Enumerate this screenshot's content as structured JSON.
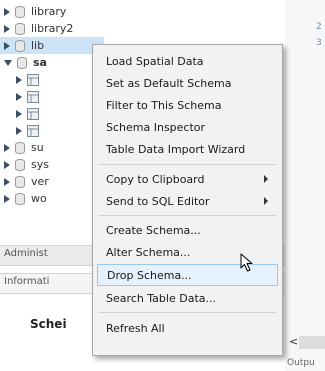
{
  "tree": {
    "items": [
      {
        "label": "library",
        "state": "collapsed",
        "kind": "schema"
      },
      {
        "label": "library2",
        "state": "collapsed",
        "kind": "schema"
      },
      {
        "label": "lib",
        "state": "collapsed",
        "kind": "schema",
        "selected": true
      },
      {
        "label": "sa",
        "state": "expanded",
        "kind": "schema",
        "bold": true
      },
      {
        "label": "",
        "state": "collapsed",
        "kind": "folder"
      },
      {
        "label": "",
        "state": "collapsed",
        "kind": "folder"
      },
      {
        "label": "",
        "state": "collapsed",
        "kind": "folder"
      },
      {
        "label": "",
        "state": "collapsed",
        "kind": "folder"
      },
      {
        "label": "su",
        "state": "collapsed",
        "kind": "schema"
      },
      {
        "label": "sys",
        "state": "collapsed",
        "kind": "schema"
      },
      {
        "label": "ver",
        "state": "collapsed",
        "kind": "schema"
      },
      {
        "label": "wo",
        "state": "collapsed",
        "kind": "schema"
      }
    ]
  },
  "panels": {
    "administration_tab": "Administ",
    "information_tab": "Informati",
    "schema_label": "Schei"
  },
  "editor": {
    "line_numbers": [
      "2",
      "3"
    ],
    "output_label": "Outpu",
    "scroll_left": "<"
  },
  "context_menu": {
    "items": [
      {
        "label": "Load Spatial Data",
        "submenu": false
      },
      {
        "label": "Set as Default Schema",
        "submenu": false
      },
      {
        "label": "Filter to This Schema",
        "submenu": false
      },
      {
        "label": "Schema Inspector",
        "submenu": false
      },
      {
        "label": "Table Data Import Wizard",
        "submenu": false
      },
      {
        "label": "Copy to Clipboard",
        "submenu": true
      },
      {
        "label": "Send to SQL Editor",
        "submenu": true
      },
      {
        "label": "Create Schema...",
        "submenu": false
      },
      {
        "label": "Alter Schema...",
        "submenu": false
      },
      {
        "label": "Drop Schema...",
        "submenu": false,
        "hovered": true
      },
      {
        "label": "Search Table Data...",
        "submenu": false
      },
      {
        "label": "Refresh All",
        "submenu": false
      }
    ]
  },
  "colors": {
    "selection": "#cde3f7",
    "menu_hover": "#e5f1fb",
    "menu_hover_border": "#99c8f0",
    "line_number": "#6f8fb0"
  }
}
